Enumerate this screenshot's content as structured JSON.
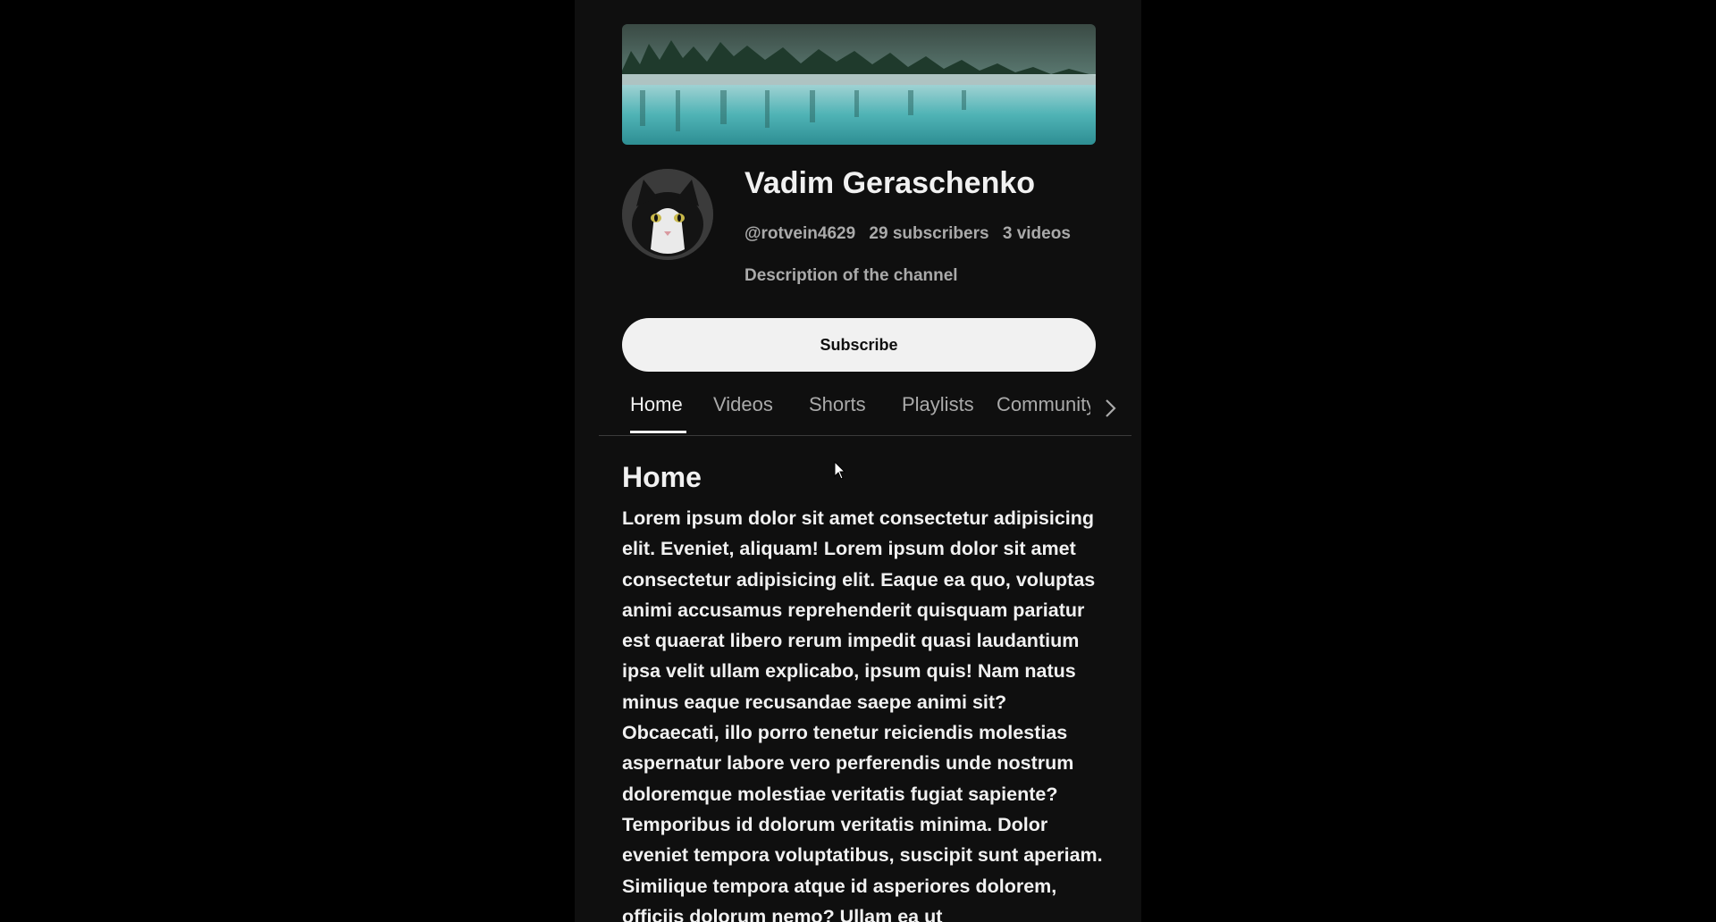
{
  "channel": {
    "name": "Vadim Geraschenko",
    "handle": "@rotvein4629",
    "subscribers": "29 subscribers",
    "videos": "3 videos",
    "description": "Description of the channel"
  },
  "subscribe_button": {
    "label": "Subscribe"
  },
  "tabs": [
    {
      "label": "Home",
      "active": true
    },
    {
      "label": "Videos",
      "active": false
    },
    {
      "label": "Shorts",
      "active": false
    },
    {
      "label": "Playlists",
      "active": false
    },
    {
      "label": "Community",
      "active": false
    }
  ],
  "home_section": {
    "title": "Home",
    "body": "Lorem ipsum dolor sit amet consectetur adipisicing elit. Eveniet, aliquam! Lorem ipsum dolor sit amet consectetur adipisicing elit. Eaque ea quo, voluptas animi accusamus reprehenderit quisquam pariatur est quaerat libero rerum impedit quasi laudantium ipsa velit ullam explicabo, ipsum quis! Nam natus minus eaque recusandae saepe animi sit? Obcaecati, illo porro tenetur reiciendis molestias aspernatur labore vero perferendis unde nostrum doloremque molestiae veritatis fugiat sapiente? Temporibus id dolorum veritatis minima. Dolor eveniet tempora voluptatibus, suscipit sunt aperiam. Similique tempora atque id asperiores dolorem, officiis dolorum nemo? Ullam ea ut"
  },
  "icons": {
    "tabs_next": "chevron-right-icon",
    "cursor": "mouse-pointer-icon"
  },
  "colors": {
    "page_background": "#0f0f0f",
    "outer_background": "#000000",
    "text_primary": "#f1f1f1",
    "text_secondary": "#aaaaaa",
    "button_background": "#f1f1f1"
  }
}
